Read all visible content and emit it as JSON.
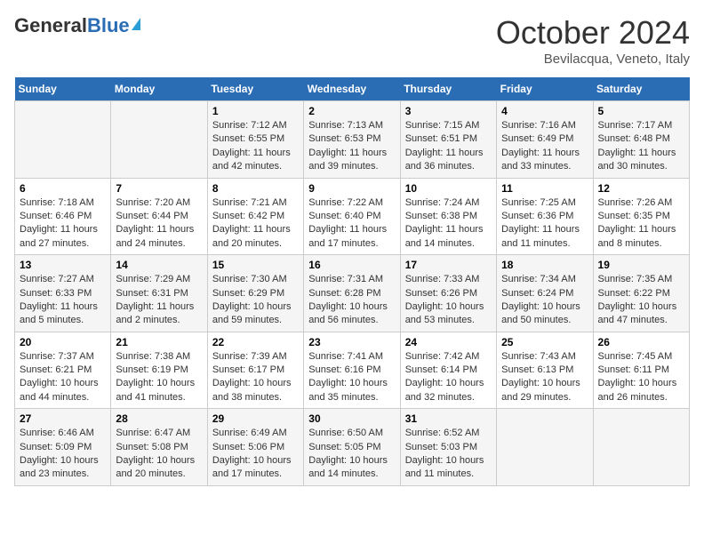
{
  "header": {
    "logo_general": "General",
    "logo_blue": "Blue",
    "month": "October 2024",
    "location": "Bevilacqua, Veneto, Italy"
  },
  "days_of_week": [
    "Sunday",
    "Monday",
    "Tuesday",
    "Wednesday",
    "Thursday",
    "Friday",
    "Saturday"
  ],
  "weeks": [
    [
      {
        "day": "",
        "info": ""
      },
      {
        "day": "",
        "info": ""
      },
      {
        "day": "1",
        "info": "Sunrise: 7:12 AM\nSunset: 6:55 PM\nDaylight: 11 hours and 42 minutes."
      },
      {
        "day": "2",
        "info": "Sunrise: 7:13 AM\nSunset: 6:53 PM\nDaylight: 11 hours and 39 minutes."
      },
      {
        "day": "3",
        "info": "Sunrise: 7:15 AM\nSunset: 6:51 PM\nDaylight: 11 hours and 36 minutes."
      },
      {
        "day": "4",
        "info": "Sunrise: 7:16 AM\nSunset: 6:49 PM\nDaylight: 11 hours and 33 minutes."
      },
      {
        "day": "5",
        "info": "Sunrise: 7:17 AM\nSunset: 6:48 PM\nDaylight: 11 hours and 30 minutes."
      }
    ],
    [
      {
        "day": "6",
        "info": "Sunrise: 7:18 AM\nSunset: 6:46 PM\nDaylight: 11 hours and 27 minutes."
      },
      {
        "day": "7",
        "info": "Sunrise: 7:20 AM\nSunset: 6:44 PM\nDaylight: 11 hours and 24 minutes."
      },
      {
        "day": "8",
        "info": "Sunrise: 7:21 AM\nSunset: 6:42 PM\nDaylight: 11 hours and 20 minutes."
      },
      {
        "day": "9",
        "info": "Sunrise: 7:22 AM\nSunset: 6:40 PM\nDaylight: 11 hours and 17 minutes."
      },
      {
        "day": "10",
        "info": "Sunrise: 7:24 AM\nSunset: 6:38 PM\nDaylight: 11 hours and 14 minutes."
      },
      {
        "day": "11",
        "info": "Sunrise: 7:25 AM\nSunset: 6:36 PM\nDaylight: 11 hours and 11 minutes."
      },
      {
        "day": "12",
        "info": "Sunrise: 7:26 AM\nSunset: 6:35 PM\nDaylight: 11 hours and 8 minutes."
      }
    ],
    [
      {
        "day": "13",
        "info": "Sunrise: 7:27 AM\nSunset: 6:33 PM\nDaylight: 11 hours and 5 minutes."
      },
      {
        "day": "14",
        "info": "Sunrise: 7:29 AM\nSunset: 6:31 PM\nDaylight: 11 hours and 2 minutes."
      },
      {
        "day": "15",
        "info": "Sunrise: 7:30 AM\nSunset: 6:29 PM\nDaylight: 10 hours and 59 minutes."
      },
      {
        "day": "16",
        "info": "Sunrise: 7:31 AM\nSunset: 6:28 PM\nDaylight: 10 hours and 56 minutes."
      },
      {
        "day": "17",
        "info": "Sunrise: 7:33 AM\nSunset: 6:26 PM\nDaylight: 10 hours and 53 minutes."
      },
      {
        "day": "18",
        "info": "Sunrise: 7:34 AM\nSunset: 6:24 PM\nDaylight: 10 hours and 50 minutes."
      },
      {
        "day": "19",
        "info": "Sunrise: 7:35 AM\nSunset: 6:22 PM\nDaylight: 10 hours and 47 minutes."
      }
    ],
    [
      {
        "day": "20",
        "info": "Sunrise: 7:37 AM\nSunset: 6:21 PM\nDaylight: 10 hours and 44 minutes."
      },
      {
        "day": "21",
        "info": "Sunrise: 7:38 AM\nSunset: 6:19 PM\nDaylight: 10 hours and 41 minutes."
      },
      {
        "day": "22",
        "info": "Sunrise: 7:39 AM\nSunset: 6:17 PM\nDaylight: 10 hours and 38 minutes."
      },
      {
        "day": "23",
        "info": "Sunrise: 7:41 AM\nSunset: 6:16 PM\nDaylight: 10 hours and 35 minutes."
      },
      {
        "day": "24",
        "info": "Sunrise: 7:42 AM\nSunset: 6:14 PM\nDaylight: 10 hours and 32 minutes."
      },
      {
        "day": "25",
        "info": "Sunrise: 7:43 AM\nSunset: 6:13 PM\nDaylight: 10 hours and 29 minutes."
      },
      {
        "day": "26",
        "info": "Sunrise: 7:45 AM\nSunset: 6:11 PM\nDaylight: 10 hours and 26 minutes."
      }
    ],
    [
      {
        "day": "27",
        "info": "Sunrise: 6:46 AM\nSunset: 5:09 PM\nDaylight: 10 hours and 23 minutes."
      },
      {
        "day": "28",
        "info": "Sunrise: 6:47 AM\nSunset: 5:08 PM\nDaylight: 10 hours and 20 minutes."
      },
      {
        "day": "29",
        "info": "Sunrise: 6:49 AM\nSunset: 5:06 PM\nDaylight: 10 hours and 17 minutes."
      },
      {
        "day": "30",
        "info": "Sunrise: 6:50 AM\nSunset: 5:05 PM\nDaylight: 10 hours and 14 minutes."
      },
      {
        "day": "31",
        "info": "Sunrise: 6:52 AM\nSunset: 5:03 PM\nDaylight: 10 hours and 11 minutes."
      },
      {
        "day": "",
        "info": ""
      },
      {
        "day": "",
        "info": ""
      }
    ]
  ]
}
